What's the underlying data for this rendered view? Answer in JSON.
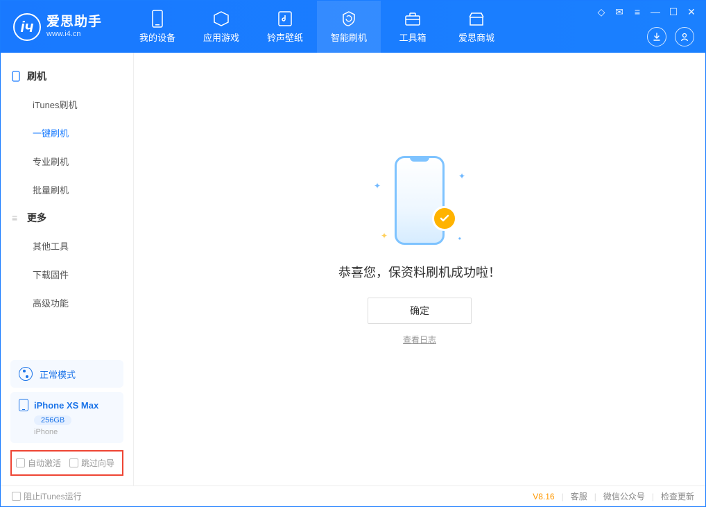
{
  "app": {
    "title": "爱思助手",
    "subtitle": "www.i4.cn"
  },
  "nav": {
    "tabs": [
      {
        "label": "我的设备",
        "icon": "device-icon"
      },
      {
        "label": "应用游戏",
        "icon": "apps-icon"
      },
      {
        "label": "铃声壁纸",
        "icon": "ringtone-icon"
      },
      {
        "label": "智能刷机",
        "icon": "flash-icon",
        "active": true
      },
      {
        "label": "工具箱",
        "icon": "toolbox-icon"
      },
      {
        "label": "爱思商城",
        "icon": "store-icon"
      }
    ]
  },
  "sidebar": {
    "section1": {
      "title": "刷机"
    },
    "items1": [
      {
        "label": "iTunes刷机"
      },
      {
        "label": "一键刷机",
        "active": true
      },
      {
        "label": "专业刷机"
      },
      {
        "label": "批量刷机"
      }
    ],
    "section2": {
      "title": "更多"
    },
    "items2": [
      {
        "label": "其他工具"
      },
      {
        "label": "下载固件"
      },
      {
        "label": "高级功能"
      }
    ],
    "mode": {
      "label": "正常模式"
    },
    "device": {
      "name": "iPhone XS Max",
      "capacity": "256GB",
      "type": "iPhone"
    },
    "checkboxes": {
      "auto_activate": "自动激活",
      "skip_guide": "跳过向导"
    }
  },
  "main": {
    "success_text": "恭喜您，保资料刷机成功啦！",
    "ok_label": "确定",
    "log_link": "查看日志"
  },
  "statusbar": {
    "block_itunes": "阻止iTunes运行",
    "version": "V8.16",
    "support": "客服",
    "wechat": "微信公众号",
    "check_update": "检查更新"
  }
}
